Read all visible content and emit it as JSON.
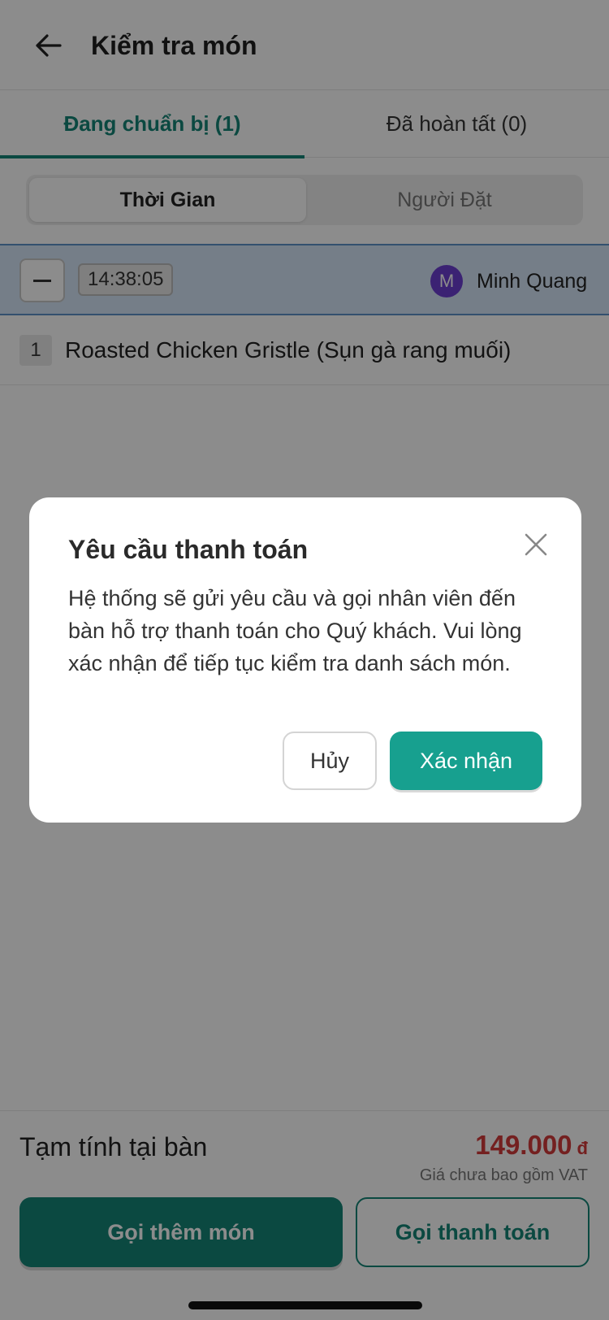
{
  "header": {
    "title": "Kiểm tra món",
    "back_icon": "arrow-left-icon"
  },
  "tabs": [
    {
      "label": "Đang chuẩn bị (1)",
      "active": true
    },
    {
      "label": "Đã hoàn tất (0)",
      "active": false
    }
  ],
  "sort": {
    "options": [
      "Thời Gian",
      "Người Đặt"
    ],
    "selected": "Thời Gian"
  },
  "order_group": {
    "time": "14:38:05",
    "avatar_letter": "M",
    "user_name": "Minh Quang"
  },
  "items": [
    {
      "qty": "1",
      "name": "Roasted Chicken Gristle (Sụn gà rang muối)"
    }
  ],
  "bottom": {
    "subtotal_label": "Tạm tính tại bàn",
    "subtotal_amount": "149.000",
    "currency": "đ",
    "vat_note": "Giá chưa bao gồm VAT",
    "order_more_label": "Gọi thêm món",
    "request_payment_label": "Gọi thanh toán"
  },
  "modal": {
    "title": "Yêu cầu thanh toán",
    "body": "Hệ thống sẽ gửi yêu cầu và gọi nhân viên đến bàn hỗ trợ thanh toán cho Quý khách. Vui lòng xác nhận để tiếp tục kiểm tra danh sách món.",
    "cancel_label": "Hủy",
    "confirm_label": "Xác nhận"
  },
  "colors": {
    "primary": "#158577",
    "confirm": "#17a08f",
    "price": "#d33b3b",
    "avatar": "#6c3fd1"
  }
}
